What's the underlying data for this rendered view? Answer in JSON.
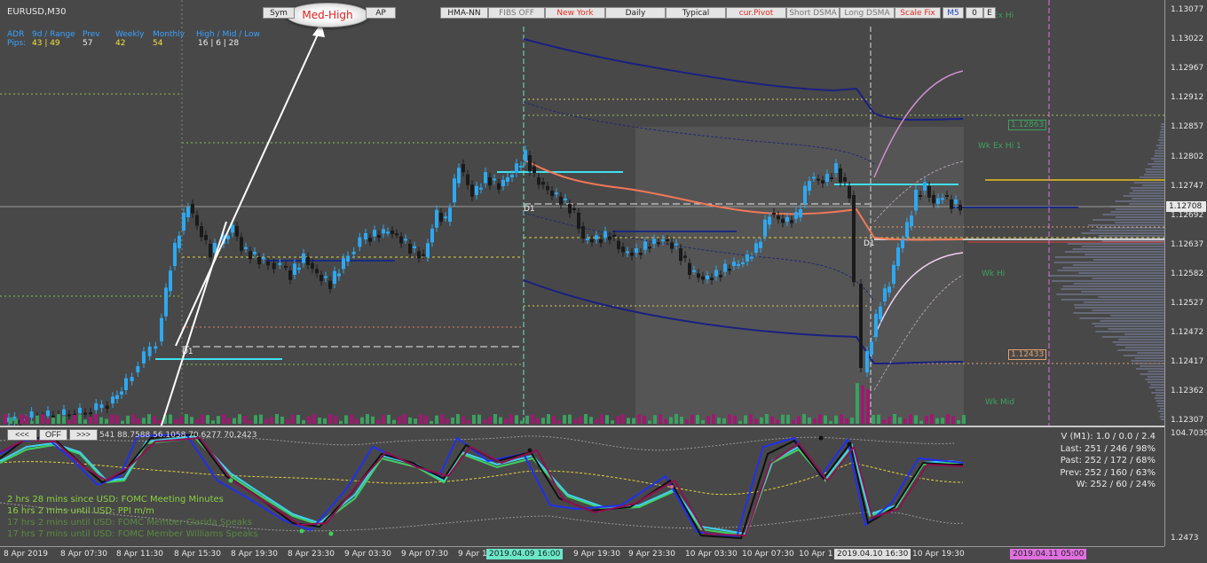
{
  "chart": {
    "symbol": "EURUSD,M30",
    "badge": "Med-High"
  },
  "toolbar": {
    "buttons": [
      {
        "label": "Sym",
        "color": "normal"
      },
      {
        "label": "AP",
        "color": "normal"
      },
      {
        "label": "HMA-NN",
        "color": "normal"
      },
      {
        "label": "FIBS OFF",
        "color": "grey"
      },
      {
        "label": "New York",
        "color": "red"
      },
      {
        "label": "Daily",
        "color": "normal"
      },
      {
        "label": "Typical",
        "color": "normal"
      },
      {
        "label": "cur.Pivot",
        "color": "red"
      },
      {
        "label": "Short DSMA",
        "color": "grey"
      },
      {
        "label": "Long DSMA",
        "color": "grey"
      },
      {
        "label": "Scale Fix",
        "color": "red"
      },
      {
        "label": "M5",
        "color": "blue"
      },
      {
        "label": "0",
        "color": "normal"
      },
      {
        "label": "E",
        "color": "normal"
      }
    ]
  },
  "adr": {
    "headers": {
      "adr": "ADR",
      "range": "9d / Range",
      "prev": "Prev",
      "weekly": "Weekly",
      "monthly": "Monthly",
      "hml": "High / Mid / Low"
    },
    "row_label": "Pips:",
    "values": {
      "range": "43 | 49",
      "prev": "57",
      "weekly": "42",
      "monthly": "54",
      "hml": "16  |  6  |  28"
    }
  },
  "price_axis": {
    "ticks": [
      "1.13077",
      "1.13022",
      "1.12967",
      "1.12912",
      "1.12857",
      "1.12802",
      "1.12747",
      "1.12692",
      "1.12637",
      "1.12582",
      "1.12527",
      "1.12472",
      "1.12417",
      "1.12362",
      "1.12307"
    ],
    "current_price": "1.12708",
    "osc_max": "104.7039",
    "osc_min": "1.2473"
  },
  "price_labels": [
    {
      "text": "1.12863",
      "color": "#3fa060"
    },
    {
      "text": "1.12433",
      "color": "#e0a070"
    }
  ],
  "level_labels": {
    "wk_ex_hi": "Wk Ex Hi",
    "wk_ex_hi_1": "Wk Ex Hi 1",
    "wk_hi": "Wk Hi",
    "wk_mid": "Wk Mid",
    "d1_a": "D1",
    "d1_b": "D1",
    "d1_c": "D1"
  },
  "time_axis": {
    "ticks": [
      "8 Apr 2019",
      "8 Apr 07:30",
      "8 Apr 11:30",
      "8 Apr 15:30",
      "8 Apr 19:30",
      "8 Apr 23:30",
      "9 Apr 03:30",
      "9 Apr 07:30",
      "9 Apr 1",
      "9 Apr 19:30",
      "9 Apr 23:30",
      "10 Apr 03:30",
      "10 Apr 07:30",
      "10 Apr 1",
      "10 Apr 19:30"
    ],
    "highlight_1": "2019.04.09 16:00",
    "highlight_2": "2019.04.10 16:30",
    "highlight_3": "2019.04.11 05:00"
  },
  "oscillator": {
    "nav_prev": "<<<",
    "nav_off": "OFF",
    "nav_next": ">>>",
    "values_text": "541 88.7588 56.1058 70.6277 70.2423"
  },
  "volume_stats": {
    "v": "V (M1): 1.0 / 0.0 / 2.4",
    "last": "Last: 251 / 246 / 98%",
    "past": "Past: 252 / 172 / 68%",
    "prev": "Prev: 252 / 160 / 63%",
    "w": "W: 252 / 60 / 24%"
  },
  "events": [
    {
      "text": "2 hrs 28 mins since USD: FOMC Meeting Minutes",
      "color": "#8ad040"
    },
    {
      "text": "16 hrs 2 mins until USD: PPI m/m",
      "color": "#8ad040"
    },
    {
      "text": "17 hrs 2 mins until USD: FOMC Member Clarida Speaks",
      "color": "#5a8a40"
    },
    {
      "text": "17 hrs 7 mins until USD: FOMC Member Williams Speaks",
      "color": "#5a8a40"
    }
  ]
}
